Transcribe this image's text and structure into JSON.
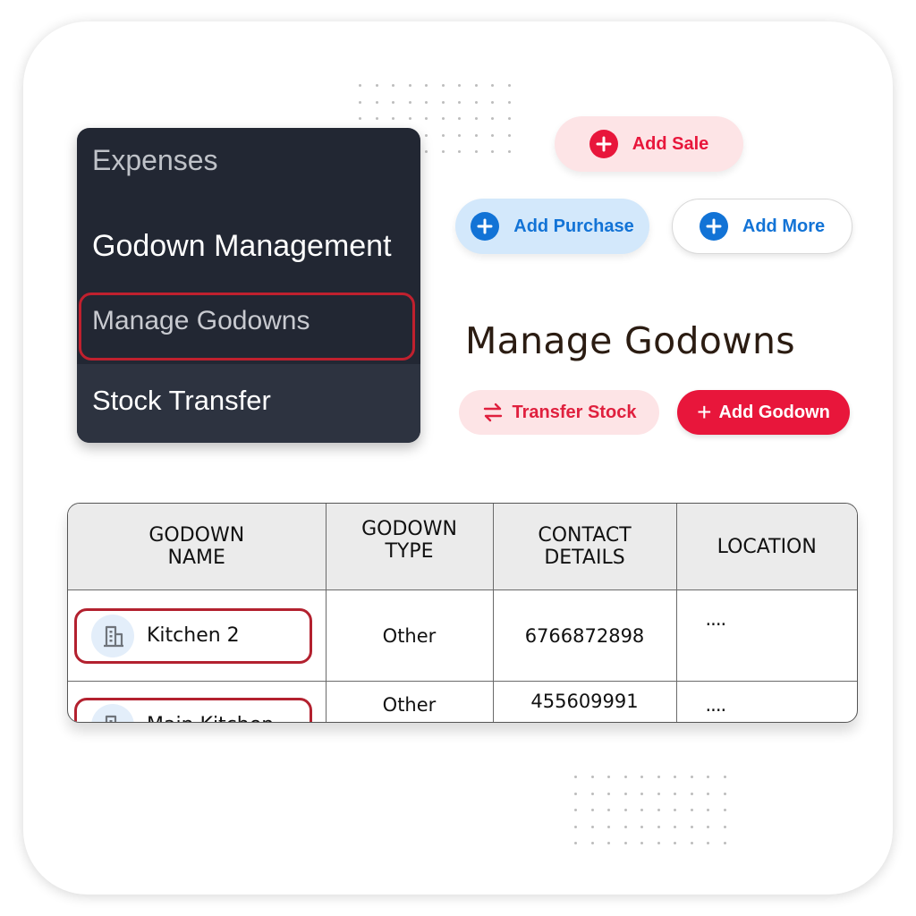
{
  "sidebar": {
    "items": [
      {
        "label": "Expenses"
      },
      {
        "label": "Godown Management"
      },
      {
        "label": "Manage Godowns",
        "highlighted": true
      },
      {
        "label": "Stock Transfer"
      }
    ]
  },
  "quick_actions": {
    "add_sale": "Add Sale",
    "add_purchase": "Add Purchase",
    "add_more": "Add More"
  },
  "page": {
    "title": "Manage Godowns",
    "transfer_stock": "Transfer Stock",
    "add_godown": "Add Godown"
  },
  "table": {
    "headers": [
      "GODOWN NAME",
      "GODOWN TYPE",
      "CONTACT DETAILS",
      "LOCATION"
    ],
    "header_lines": [
      [
        "GODOWN",
        "NAME"
      ],
      [
        "GODOWN",
        "TYPE"
      ],
      [
        "CONTACT",
        "DETAILS"
      ],
      [
        "LOCATION"
      ]
    ],
    "rows": [
      {
        "name": "Kitchen 2",
        "type": "Other",
        "contact": "6766872898",
        "location": "...."
      },
      {
        "name": "Main Kitchen",
        "type": "Other",
        "contact": "455609991",
        "location": "...."
      }
    ]
  },
  "icons": {
    "plus": "plus-circle-icon",
    "transfer": "swap-arrows-icon",
    "building": "building-icon"
  },
  "colors": {
    "sale_red": "#e8163b",
    "sale_bg": "#fde4e6",
    "purchase_blue": "#1273d6",
    "purchase_bg": "#d3e8fb",
    "menu_bg": "#222733",
    "highlight_border": "#b3212f",
    "title_color": "#2b1c12"
  }
}
